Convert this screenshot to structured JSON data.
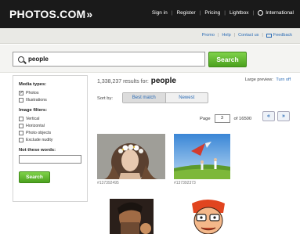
{
  "header": {
    "logo_text": "PHOTOS.COM",
    "logo_arrows": "»",
    "nav": [
      "Sign in",
      "Register",
      "Pricing",
      "Lightbox"
    ],
    "international": "International"
  },
  "subnav": {
    "links": [
      "Promo",
      "Help",
      "Contact us"
    ],
    "feedback": "Feedback"
  },
  "search": {
    "query": "people",
    "button": "Search"
  },
  "sidebar": {
    "media_heading": "Media types:",
    "media_options": [
      {
        "label": "Photos",
        "checked": true
      },
      {
        "label": "Illustrations",
        "checked": false
      }
    ],
    "filters_heading": "Image filters:",
    "filter_options": [
      {
        "label": "Vertical",
        "checked": false
      },
      {
        "label": "Horizontal",
        "checked": false
      },
      {
        "label": "Photo objects",
        "checked": false
      },
      {
        "label": "Exclude nudity",
        "checked": false
      }
    ],
    "not_words_heading": "Not these words:",
    "button": "Search"
  },
  "results": {
    "count_text": "1,338,237 results for:",
    "term": "people",
    "large_preview_label": "Large preview:",
    "large_preview_action": "Turn off"
  },
  "sort": {
    "label": "Sort by:",
    "options": [
      "Best match",
      "Newest"
    ],
    "selected": "Best match"
  },
  "pagination": {
    "page_label": "Page",
    "current": "3",
    "of_label": "of 16500",
    "prev": "«",
    "next": "»"
  },
  "thumbnails": [
    {
      "id": "#137392495",
      "subject": "woman-with-flower-crown"
    },
    {
      "id": "#137392373",
      "subject": "couple-with-kite-on-grass"
    },
    {
      "id": "",
      "subject": "man-portrait"
    },
    {
      "id": "",
      "subject": "cartoon-illustration"
    }
  ],
  "colors": {
    "topbar": "#1a1a1a",
    "accent_green": "#5cb82a",
    "link_blue": "#2a6bb5"
  }
}
